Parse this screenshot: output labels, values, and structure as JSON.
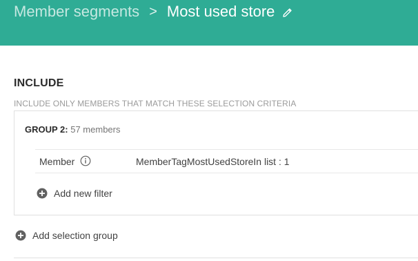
{
  "header": {
    "parent_crumb": "Member segments",
    "separator": ">",
    "current_crumb": "Most used store",
    "edit_icon": "pencil-icon",
    "color": "#2fac95"
  },
  "include": {
    "title": "INCLUDE",
    "subtitle": "INCLUDE ONLY MEMBERS THAT MATCH THESE SELECTION CRITERIA"
  },
  "group": {
    "label": "GROUP 2:",
    "count": "57 members",
    "filters": [
      {
        "field": "Member",
        "info_icon": "info-icon",
        "value": "MemberTagMostUsedStoreIn list : 1"
      }
    ],
    "add_filter_label": "Add new filter"
  },
  "add_selection_label": "Add selection group"
}
